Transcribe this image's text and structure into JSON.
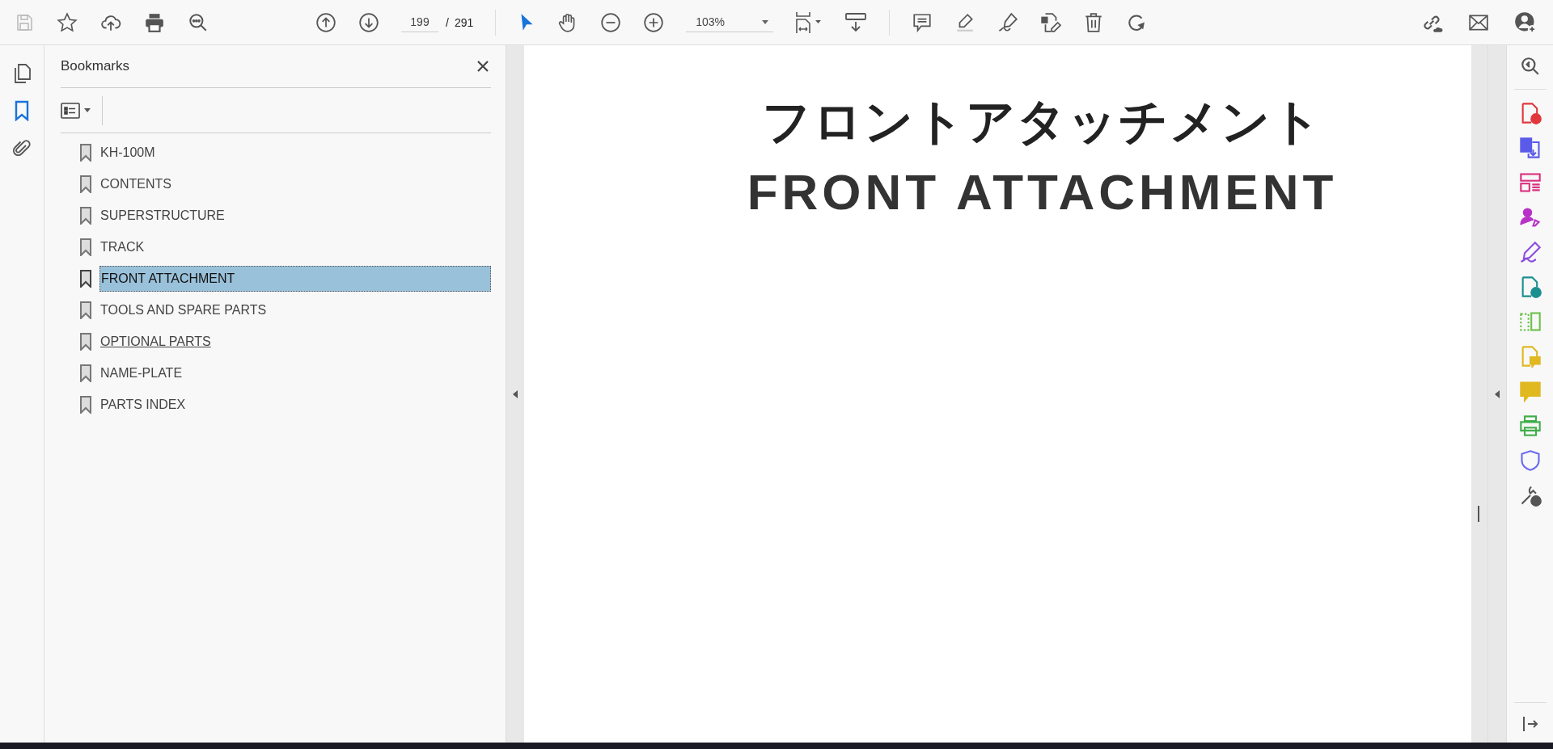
{
  "toolbar": {
    "save_disabled": true,
    "page_current": "199",
    "page_separator": "/",
    "page_total": "291",
    "zoom": "103%"
  },
  "nav_rail": [
    {
      "kind": "pages",
      "selected": false
    },
    {
      "kind": "bookmarks",
      "selected": true
    },
    {
      "kind": "attachments",
      "selected": false
    }
  ],
  "bookmarks_panel": {
    "title": "Bookmarks",
    "items": [
      {
        "label": "KH-100M",
        "selected": false,
        "hovered": false
      },
      {
        "label": "CONTENTS",
        "selected": false,
        "hovered": false
      },
      {
        "label": "SUPERSTRUCTURE",
        "selected": false,
        "hovered": false
      },
      {
        "label": "TRACK",
        "selected": false,
        "hovered": false
      },
      {
        "label": "FRONT ATTACHMENT",
        "selected": true,
        "hovered": false
      },
      {
        "label": "TOOLS AND SPARE PARTS",
        "selected": false,
        "hovered": false
      },
      {
        "label": "OPTIONAL PARTS",
        "selected": false,
        "hovered": true
      },
      {
        "label": "NAME-PLATE",
        "selected": false,
        "hovered": false
      },
      {
        "label": "PARTS INDEX",
        "selected": false,
        "hovered": false
      }
    ]
  },
  "document": {
    "title_japanese": "フロントアタッチメント",
    "title_english": "FRONT ATTACHMENT"
  },
  "tools_rail": [
    {
      "kind": "create",
      "color": "#e0383e"
    },
    {
      "kind": "combine",
      "color": "#5b5bea"
    },
    {
      "kind": "organize",
      "color": "#d9307f"
    },
    {
      "kind": "request-sign",
      "color": "#b832c8"
    },
    {
      "kind": "fill-sign",
      "color": "#8a4de0"
    },
    {
      "kind": "export",
      "color": "#1a8f8f"
    },
    {
      "kind": "scan",
      "color": "#6cc04a"
    },
    {
      "kind": "document-comment",
      "color": "#e0b820"
    },
    {
      "kind": "comment",
      "color": "#e0b820"
    },
    {
      "kind": "print",
      "color": "#3fae49"
    },
    {
      "kind": "protect",
      "color": "#6a6af0"
    },
    {
      "kind": "more-tools",
      "color": "#555555"
    }
  ]
}
